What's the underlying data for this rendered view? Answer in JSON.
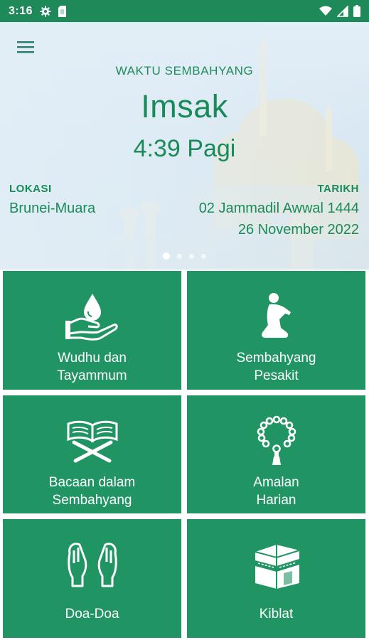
{
  "status_bar": {
    "time": "3:16"
  },
  "hero": {
    "section_label": "WAKTU SEMBAHYANG",
    "prayer_name": "Imsak",
    "prayer_time": "4:39 Pagi",
    "location_label": "LOKASI",
    "location_value": "Brunei-Muara",
    "date_label": "TARIKH",
    "hijri_date": "02 Jammadil Awwal 1444",
    "gregorian_date": "26 November 2022",
    "carousel_pages": 4,
    "carousel_active": 1
  },
  "tiles": [
    {
      "label": "Wudhu dan\nTayammum",
      "icon": "hand-water-drop-icon"
    },
    {
      "label": "Sembahyang\nPesakit",
      "icon": "praying-person-icon"
    },
    {
      "label": "Bacaan dalam\nSembahyang",
      "icon": "quran-stand-icon"
    },
    {
      "label": "Amalan\nHarian",
      "icon": "prayer-beads-icon"
    },
    {
      "label": "Doa-Doa",
      "icon": "praying-hands-icon"
    },
    {
      "label": "Kiblat",
      "icon": "kaaba-icon"
    }
  ],
  "colors": {
    "brand_green": "#219463",
    "status_bar": "#1e8a5a",
    "hero_text": "#1a8a58"
  }
}
